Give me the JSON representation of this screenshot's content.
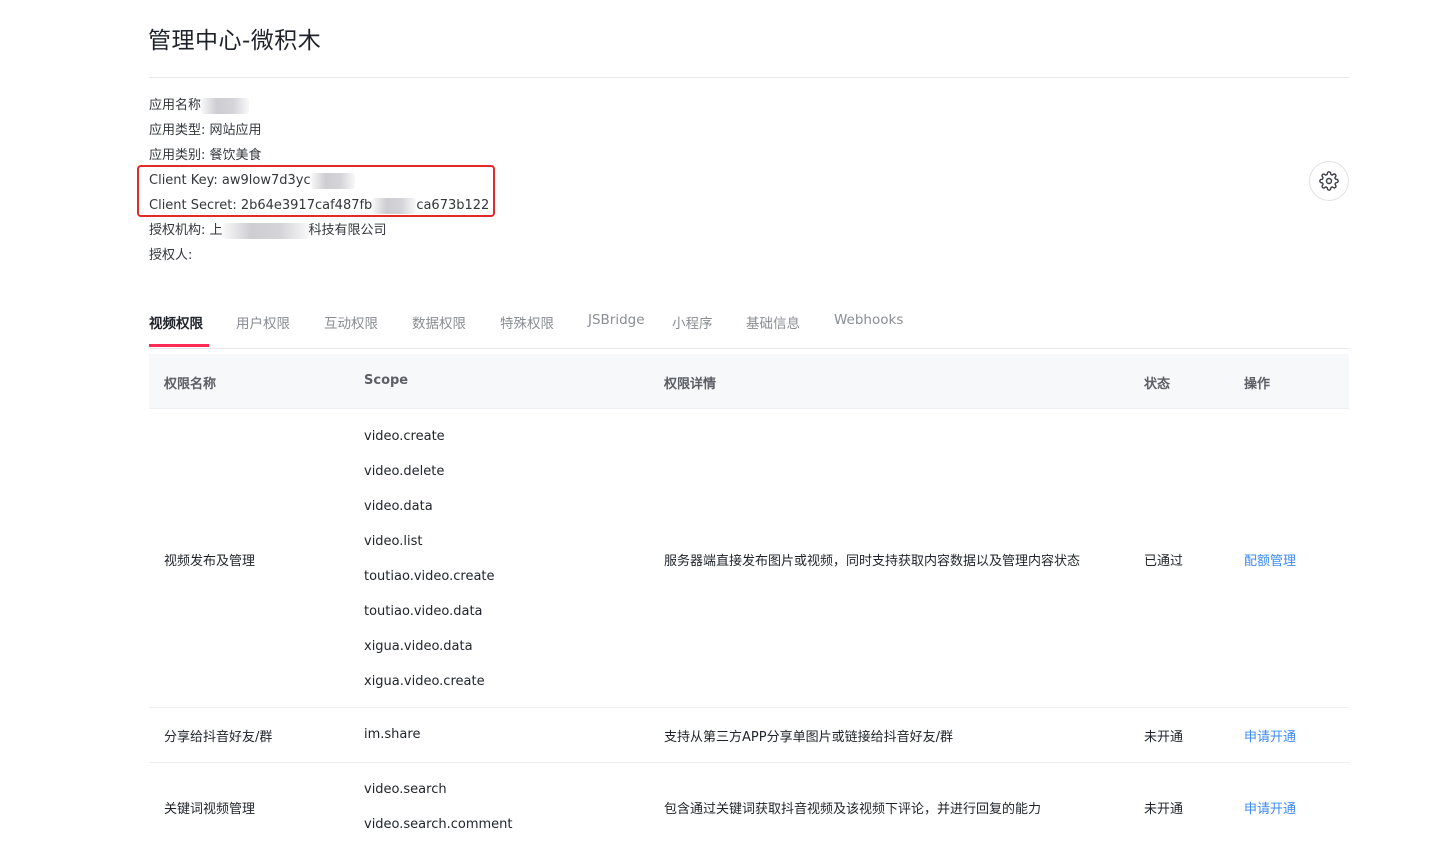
{
  "page": {
    "title": "管理中心-微积木"
  },
  "app_info": {
    "name_label": "应用名称",
    "type_label": "应用类型: 网站应用",
    "category_label": "应用类别: 餐饮美食",
    "client_key_label": "Client Key: aw9low7d3yc",
    "client_secret_prefix": "Client Secret: 2b64e3917caf487fb",
    "client_secret_suffix": "ca673b122",
    "org_prefix": "授权机构: 上",
    "org_suffix": "科技有限公司",
    "authorizer_label": "授权人:"
  },
  "icons": {
    "settings": "gear-icon"
  },
  "colors": {
    "accent": "#fe2c55",
    "link": "#3c8bf5",
    "highlight": "#e32a2a"
  },
  "tabs": [
    {
      "label": "视频权限",
      "active": true
    },
    {
      "label": "用户权限"
    },
    {
      "label": "互动权限"
    },
    {
      "label": "数据权限"
    },
    {
      "label": "特殊权限"
    },
    {
      "label": "JSBridge"
    },
    {
      "label": "小程序"
    },
    {
      "label": "基础信息"
    },
    {
      "label": "Webhooks"
    }
  ],
  "table": {
    "headers": {
      "name": "权限名称",
      "scope": "Scope",
      "detail": "权限详情",
      "status": "状态",
      "action": "操作"
    },
    "rows": [
      {
        "name": "视频发布及管理",
        "scopes": [
          "video.create",
          "video.delete",
          "video.data",
          "video.list",
          "toutiao.video.create",
          "toutiao.video.data",
          "xigua.video.data",
          "xigua.video.create"
        ],
        "detail": "服务器端直接发布图片或视频，同时支持获取内容数据以及管理内容状态",
        "status": "已通过",
        "action": "配额管理"
      },
      {
        "name": "分享给抖音好友/群",
        "scopes": [
          "im.share"
        ],
        "detail": "支持从第三方APP分享单图片或链接给抖音好友/群",
        "status": "未开通",
        "action": "申请开通"
      },
      {
        "name": "关键词视频管理",
        "scopes": [
          "video.search",
          "video.search.comment"
        ],
        "detail": "包含通过关键词获取抖音视频及该视频下评论，并进行回复的能力",
        "status": "未开通",
        "action": "申请开通"
      }
    ]
  }
}
